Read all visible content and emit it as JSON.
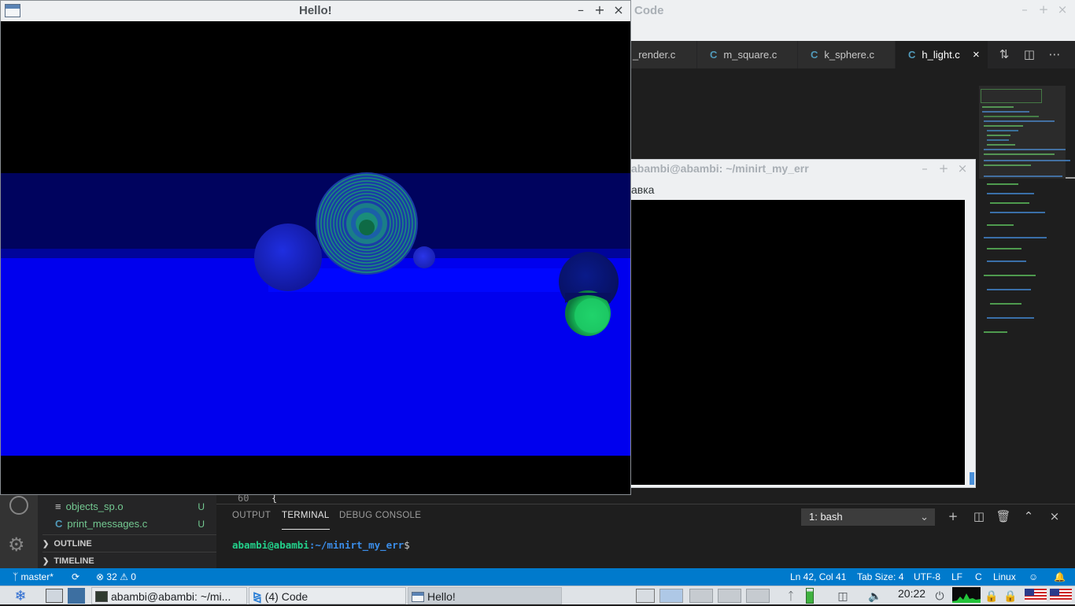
{
  "vscode": {
    "title": "Code",
    "tabs": [
      {
        "label": "_render.c",
        "icon": "c-file-icon",
        "active": false
      },
      {
        "label": "m_square.c",
        "icon": "c-file-icon",
        "active": false
      },
      {
        "label": "k_sphere.c",
        "icon": "c-file-icon",
        "active": false
      },
      {
        "label": "h_light.c",
        "icon": "c-file-icon",
        "active": true
      }
    ],
    "explorer_files": [
      {
        "label": "objects_sp.o",
        "icon": "lines-icon",
        "badge": "U"
      },
      {
        "label": "print_messages.c",
        "icon": "c-file-icon",
        "badge": "U"
      }
    ],
    "sections": [
      "OUTLINE",
      "TIMELINE"
    ],
    "code_line": {
      "number": "60",
      "text": "{"
    },
    "panel": {
      "tabs": [
        "OUTPUT",
        "TERMINAL",
        "DEBUG CONSOLE"
      ],
      "active_tab": "TERMINAL",
      "terminal_select": "1: bash",
      "prompt_user": "abambi@abambi",
      "prompt_path": ":~/minirt_my_err",
      "prompt_symbol": "$"
    },
    "statusbar": {
      "branch": "master*",
      "errors": "32",
      "warnings": "0",
      "position": "Ln 42, Col 41",
      "tab_size": "Tab Size: 4",
      "encoding": "UTF-8",
      "eol": "LF",
      "language": "C",
      "os": "Linux"
    }
  },
  "terminal_window": {
    "title": "abambi@abambi: ~/minirt_my_err",
    "menu_label": "авка"
  },
  "hello_window": {
    "title": "Hello!"
  },
  "taskbar": {
    "tasks": [
      {
        "label": "abambi@abambi: ~/mi...",
        "icon": "terminal-icon"
      },
      {
        "label": "(4) Code",
        "icon": "vscode-icon"
      },
      {
        "label": "Hello!",
        "icon": "window-icon",
        "active": true
      }
    ],
    "clock": "20:22"
  },
  "colors": {
    "status_blue": "#007acc",
    "terminal_green": "#23d18b",
    "terminal_blue": "#3b8eea",
    "render_plane_blue": "#0000ee"
  }
}
